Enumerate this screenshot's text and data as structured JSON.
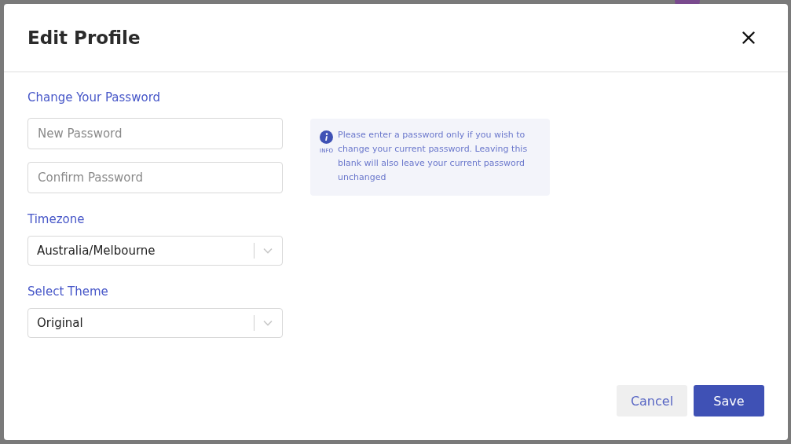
{
  "dialog": {
    "title": "Edit Profile"
  },
  "password_section": {
    "heading": "Change Your Password",
    "fields": [
      {
        "placeholder": "New Password"
      },
      {
        "placeholder": "Confirm Password"
      }
    ],
    "info": {
      "label": "INFO",
      "text": "Please enter a password only if you wish to change your current password. Leaving this blank will also leave your current password unchanged"
    }
  },
  "selects": [
    {
      "label": "Timezone",
      "value": "Australia/Melbourne"
    },
    {
      "label": "Select Theme",
      "value": "Original"
    }
  ],
  "buttons": [
    {
      "label": "Cancel",
      "kind": "secondary"
    },
    {
      "label": "Save",
      "kind": "primary"
    }
  ]
}
